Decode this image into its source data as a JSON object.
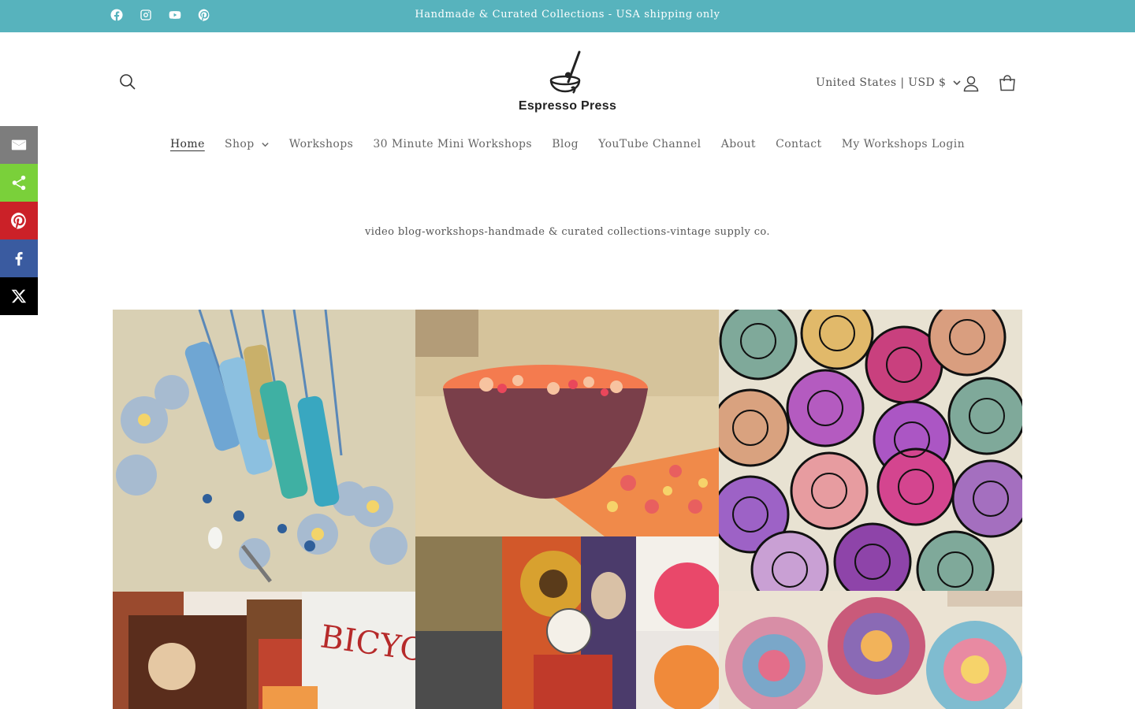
{
  "announcement": {
    "text": "Handmade & Curated Collections - USA shipping only",
    "background": "#57b3bd",
    "social_icons": [
      "facebook-icon",
      "instagram-icon",
      "youtube-icon",
      "pinterest-icon"
    ]
  },
  "header": {
    "brand": "Espresso Press",
    "country_selector": "United States | USD $",
    "icons": [
      "search-icon",
      "account-icon",
      "cart-icon"
    ]
  },
  "nav": {
    "items": [
      {
        "label": "Home",
        "active": true
      },
      {
        "label": "Shop",
        "has_dropdown": true
      },
      {
        "label": "Workshops"
      },
      {
        "label": "30 Minute Mini Workshops"
      },
      {
        "label": "Blog"
      },
      {
        "label": "YouTube Channel"
      },
      {
        "label": "About"
      },
      {
        "label": "Contact"
      },
      {
        "label": "My Workshops Login"
      }
    ]
  },
  "tagline": "video blog-workshops-handmade & curated collections-vintage supply co.",
  "share_bar": {
    "buttons": [
      {
        "icon": "email-icon",
        "color": "#7d7d7d"
      },
      {
        "icon": "share-icon",
        "color": "#7ad03a"
      },
      {
        "icon": "pinterest-icon",
        "color": "#cb2128"
      },
      {
        "icon": "facebook-icon",
        "color": "#3a5ba0"
      },
      {
        "icon": "x-icon",
        "color": "#000000"
      }
    ]
  },
  "gallery": {
    "images": [
      "paper-bead-necklaces",
      "decoupage-bowl",
      "mandala-discs",
      "vintage-cards-collage",
      "ephemera-collage",
      "fabric-rosettes"
    ]
  }
}
